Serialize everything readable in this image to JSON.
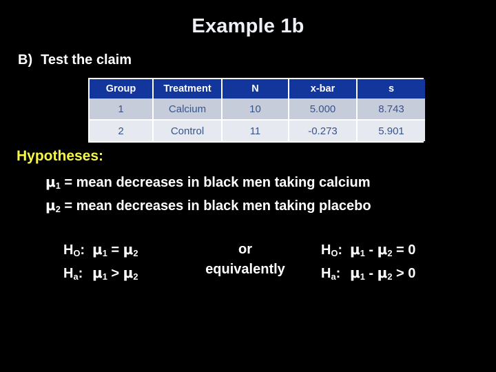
{
  "slide": {
    "title": "Example 1b",
    "background_color": "#000000",
    "title_color": "#eef0f7"
  },
  "bullet": {
    "marker": "B)",
    "text": "Test the claim"
  },
  "table": {
    "header_bg": "#12369b",
    "header_text_color": "#ffffff",
    "row_odd_bg": "#c7ccda",
    "row_even_bg": "#e7e9f1",
    "cell_text_color": "#36558c",
    "columns": [
      "Group",
      "Treatment",
      "N",
      "x-bar",
      "s"
    ],
    "rows": [
      [
        "1",
        "Calcium",
        "10",
        "5.000",
        "8.743"
      ],
      [
        "2",
        "Control",
        "11",
        "-0.273",
        "5.901"
      ]
    ]
  },
  "hypotheses": {
    "heading": "Hypotheses:",
    "heading_color": "#f7f748",
    "definitions": [
      {
        "symbol": "μ",
        "subscript": "1",
        "text": "= mean decreases in black men taking calcium"
      },
      {
        "symbol": "μ",
        "subscript": "2",
        "text": "= mean decreases in black men taking placebo"
      }
    ],
    "left_block": {
      "null_label": "H",
      "null_sub": "O",
      "null_statement": "μ1 = μ2",
      "alt_label": "H",
      "alt_sub": "a",
      "alt_statement": "μ1 > μ2"
    },
    "connector": {
      "line1": "or",
      "line2": "equivalently"
    },
    "right_block": {
      "null_label": "H",
      "null_sub": "O",
      "null_statement": "μ1 - μ2 = 0",
      "alt_label": "H",
      "alt_sub": "a",
      "alt_statement": "μ1 - μ2 > 0"
    },
    "parts": {
      "mu": "μ",
      "sub1": "1",
      "sub2": "2",
      "eq": "=",
      "gt": ">",
      "minus": "-",
      "zero": "0",
      "colon": ":"
    }
  }
}
